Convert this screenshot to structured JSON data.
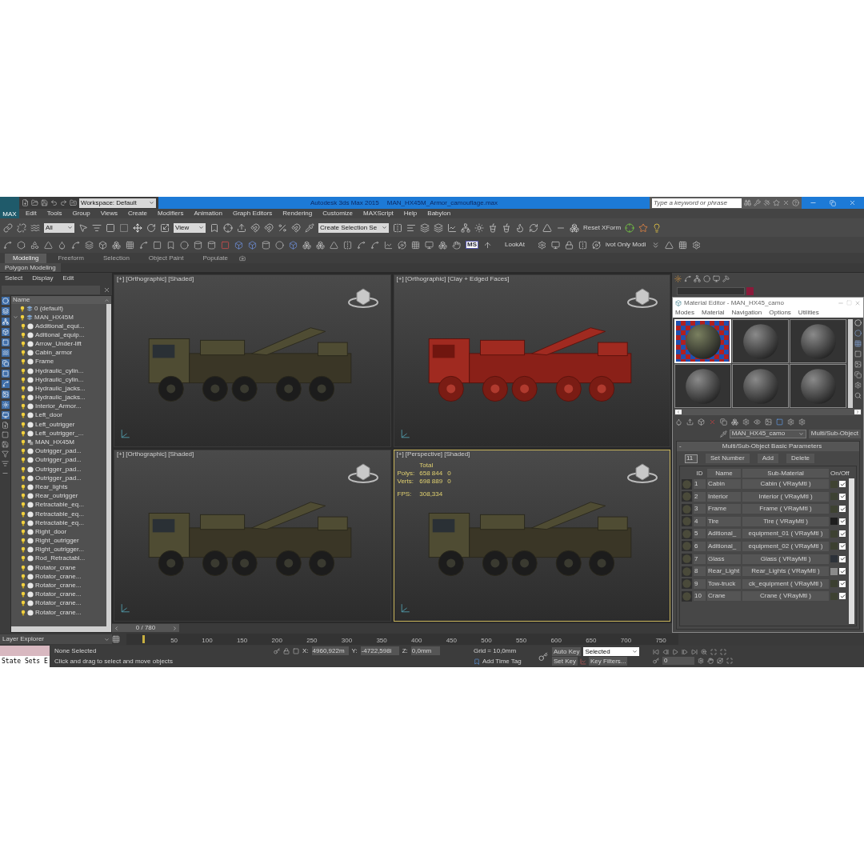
{
  "title_bar": {
    "logo": "MAX",
    "workspace": "Workspace: Default",
    "app": "Autodesk 3ds Max 2015",
    "file": "MAN_HX45M_Armor_camouflage.max",
    "search_placeholder": "Type a keyword or phrase"
  },
  "menu": [
    "Edit",
    "Tools",
    "Group",
    "Views",
    "Create",
    "Modifiers",
    "Animation",
    "Graph Editors",
    "Rendering",
    "Customize",
    "MAXScript",
    "Help",
    "Babylon"
  ],
  "main_toolbar": {
    "selection_filter": "All",
    "reference_coord": "View",
    "named_selection": "Create Selection Se",
    "reset_xform": "Reset XForm"
  },
  "extra_toolbar": {
    "maxscript": "MS",
    "lookat": "LookAt",
    "pivot": "ivot Only Modi"
  },
  "ribbon": {
    "tabs": [
      {
        "label": "Modeling",
        "selected": true
      },
      {
        "label": "Freeform",
        "selected": false
      },
      {
        "label": "Selection",
        "selected": false
      },
      {
        "label": "Object Paint",
        "selected": false
      },
      {
        "label": "Populate",
        "selected": false
      }
    ],
    "panel": "Polygon Modeling"
  },
  "scene_explorer": {
    "menu": [
      "Select",
      "Display",
      "Edit"
    ],
    "column": "Name",
    "layers": [
      {
        "name": "0 (default)",
        "kind": "layer",
        "expanded": false
      },
      {
        "name": "MAN_HX45M",
        "kind": "layer",
        "expanded": true,
        "children": [
          {
            "name": "Additional_equi...",
            "kind": "object"
          },
          {
            "name": "Aditional_equip...",
            "kind": "object"
          },
          {
            "name": "Arrow_Under-lift",
            "kind": "object"
          },
          {
            "name": "Cabin_armor",
            "kind": "object"
          },
          {
            "name": "Frame",
            "kind": "object"
          },
          {
            "name": "Hydraulic_cylin...",
            "kind": "object"
          },
          {
            "name": "Hydraulic_cylin...",
            "kind": "object"
          },
          {
            "name": "Hydraulic_jacks...",
            "kind": "object"
          },
          {
            "name": "Hydraulic_jacks...",
            "kind": "object"
          },
          {
            "name": "Interior_Armor...",
            "kind": "object"
          },
          {
            "name": "Left_door",
            "kind": "object"
          },
          {
            "name": "Left_outrigger",
            "kind": "object"
          },
          {
            "name": "Left_outrigger_...",
            "kind": "object"
          },
          {
            "name": "MAN_HX45M",
            "kind": "group"
          },
          {
            "name": "Outrigger_pad...",
            "kind": "object"
          },
          {
            "name": "Outrigger_pad...",
            "kind": "object"
          },
          {
            "name": "Outrigger_pad...",
            "kind": "object"
          },
          {
            "name": "Outrigger_pad...",
            "kind": "object"
          },
          {
            "name": "Rear_lights",
            "kind": "object"
          },
          {
            "name": "Rear_outrigger",
            "kind": "object"
          },
          {
            "name": "Retractable_eq...",
            "kind": "object"
          },
          {
            "name": "Retractable_eq...",
            "kind": "object"
          },
          {
            "name": "Retractable_eq...",
            "kind": "object"
          },
          {
            "name": "Right_door",
            "kind": "object"
          },
          {
            "name": "Right_outrigger",
            "kind": "object"
          },
          {
            "name": "Right_outrigger...",
            "kind": "object"
          },
          {
            "name": "Rod_Retractabl...",
            "kind": "object"
          },
          {
            "name": "Rotator_crane",
            "kind": "object"
          },
          {
            "name": "Rotator_crane...",
            "kind": "object"
          },
          {
            "name": "Rotator_crane...",
            "kind": "object"
          },
          {
            "name": "Rotator_crane...",
            "kind": "object"
          },
          {
            "name": "Rotator_crane...",
            "kind": "object"
          },
          {
            "name": "Rotator_crane...",
            "kind": "object"
          }
        ]
      }
    ]
  },
  "viewports": [
    {
      "label": "[+] [Orthographic] [Shaded]",
      "kind": "shaded",
      "selected": false
    },
    {
      "label": "[+] [Orthographic] [Clay + Edged Faces]",
      "kind": "clay",
      "selected": false
    },
    {
      "label": "[+] [Orthographic] [Shaded]",
      "kind": "shaded",
      "selected": false
    },
    {
      "label": "[+] [Perspective] [Shaded]",
      "kind": "shaded",
      "selected": true,
      "stats": {
        "heading": "Total",
        "rows": [
          {
            "label": "Polys:",
            "value": "658 844",
            "selection": "0"
          },
          {
            "label": "Verts:",
            "value": "698 889",
            "selection": "0"
          }
        ],
        "fps_label": "FPS:",
        "fps": "308,334"
      }
    }
  ],
  "material_editor": {
    "title": "Material Editor - MAN_HX45_camo",
    "menu": [
      "Modes",
      "Material",
      "Navigation",
      "Options",
      "Utilities"
    ],
    "slots": [
      {
        "kind": "mapped",
        "selected": true
      },
      {
        "kind": "plain",
        "selected": false
      },
      {
        "kind": "plain",
        "selected": false
      },
      {
        "kind": "plain",
        "selected": false
      },
      {
        "kind": "plain",
        "selected": false
      },
      {
        "kind": "plain",
        "selected": false
      }
    ],
    "material_name": "MAN_HX45_camo",
    "material_type": "Multi/Sub-Object",
    "rollout_toggle": "-",
    "rollout": "Multi/Sub-Object Basic Parameters",
    "count": "11",
    "buttons": [
      "Set Number",
      "Add",
      "Delete"
    ],
    "columns": [
      "ID",
      "Name",
      "Sub-Material",
      "On/Off"
    ],
    "rows": [
      {
        "id": "1",
        "name": "Cabin",
        "sub": "Cabin ( VRayMtl )",
        "color": "#3f4332",
        "on": true
      },
      {
        "id": "2",
        "name": "Interior",
        "sub": "Interior ( VRayMtl )",
        "color": "#3d4233",
        "on": true
      },
      {
        "id": "3",
        "name": "Frame",
        "sub": "Frame ( VRayMtl )",
        "color": "#3e4232",
        "on": true
      },
      {
        "id": "4",
        "name": "Tire",
        "sub": "Tire ( VRayMtl )",
        "color": "#1e1e1e",
        "on": true
      },
      {
        "id": "5",
        "name": "Aditional_",
        "sub": "equipment_01 ( VRayMtl )",
        "color": "#3d4131",
        "on": true
      },
      {
        "id": "6",
        "name": "Aditional_",
        "sub": "equipment_02 ( VRayMtl )",
        "color": "#3c4030",
        "on": true
      },
      {
        "id": "7",
        "name": "Glass",
        "sub": "Glass ( VRayMtl )",
        "color": "#2c3138",
        "on": true
      },
      {
        "id": "8",
        "name": "Rear_Light",
        "sub": "Rear_Lights ( VRayMtl )",
        "color": "#8a8a8a",
        "on": true
      },
      {
        "id": "9",
        "name": "Tow-truck",
        "sub": "ck_equipment ( VRayMtl )",
        "color": "#3b3f30",
        "on": true
      },
      {
        "id": "10",
        "name": "Crane",
        "sub": "Crane ( VRayMtl )",
        "color": "#3e4232",
        "on": true
      }
    ]
  },
  "timeline": {
    "slider": "0 / 780",
    "ticks": [
      "50",
      "100",
      "150",
      "200",
      "250",
      "300",
      "350",
      "400",
      "450",
      "500",
      "550",
      "600",
      "650",
      "700",
      "750"
    ]
  },
  "status_bar": {
    "layer_explorer": "Layer Explorer",
    "state_sets": "State Sets E",
    "selection": "None Selected",
    "prompt": "Click and drag to select and move objects",
    "x_label": "X:",
    "x": "4960,922m",
    "y_label": "Y:",
    "y": "-4722,598i",
    "z_label": "Z:",
    "z": "0,0mm",
    "grid": "Grid = 10,0mm",
    "add_time_tag": "Add Time Tag",
    "auto_key": "Auto Key",
    "key_mode": "Selected",
    "set_key": "Set Key",
    "key_filters": "Key Filters...",
    "frame": "0"
  }
}
